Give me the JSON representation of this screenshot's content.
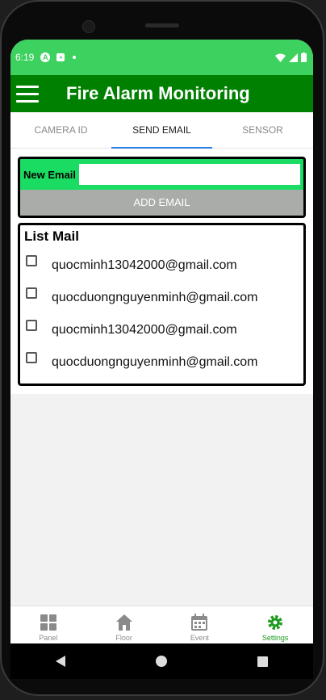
{
  "status_bar": {
    "time": "6:19",
    "icons": [
      "a-icon",
      "notification-icon",
      "dot-icon",
      "wifi-icon",
      "signal-icon",
      "battery-icon"
    ]
  },
  "app_bar": {
    "title": "Fire Alarm Monitoring",
    "menu_icon": "menu-icon"
  },
  "tabs": [
    {
      "label": "CAMERA ID"
    },
    {
      "label": "SEND EMAIL",
      "active": true
    },
    {
      "label": "SENSOR"
    }
  ],
  "email_form": {
    "label": "New Email",
    "value": "",
    "placeholder": "",
    "add_button": "ADD EMAIL"
  },
  "mail_list": {
    "title": "List Mail",
    "items": [
      {
        "email": "quocminh13042000@gmail.com",
        "checked": false
      },
      {
        "email": "quocduongnguyenminh@gmail.com",
        "checked": false
      },
      {
        "email": "quocminh13042000@gmail.com",
        "checked": false
      },
      {
        "email": "quocduongnguyenminh@gmail.com",
        "checked": false
      }
    ]
  },
  "bottom_nav": [
    {
      "label": "Panel",
      "icon": "grid-icon"
    },
    {
      "label": "Floor",
      "icon": "home-icon"
    },
    {
      "label": "Event",
      "icon": "calendar-icon"
    },
    {
      "label": "Settings",
      "icon": "gear-icon",
      "active": true
    }
  ],
  "colors": {
    "app_bar": "#008000",
    "status_bar": "#3dd15f",
    "email_box": "#1bdc63",
    "add_button": "#a9aca9",
    "tab_indicator": "#2b7de0",
    "active_nav": "#1e9b1e"
  }
}
